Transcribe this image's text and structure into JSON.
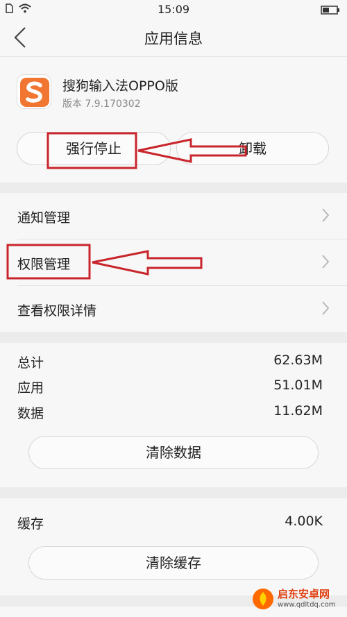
{
  "status_bar": {
    "time": "15:09",
    "icons": [
      "sim-card-icon",
      "wifi-icon",
      "battery-icon"
    ]
  },
  "header": {
    "title": "应用信息",
    "back_icon": "chevron-left-icon"
  },
  "app": {
    "name": "搜狗输入法OPPO版",
    "version": "版本 7.9.170302",
    "icon": "sogou-logo",
    "brand_color": "#f07632"
  },
  "actions": {
    "force_stop": "强行停止",
    "uninstall": "卸载"
  },
  "menu": [
    {
      "label": "通知管理",
      "icon": "chevron-right-icon"
    },
    {
      "label": "权限管理",
      "icon": "chevron-right-icon"
    },
    {
      "label": "查看权限详情",
      "icon": "chevron-right-icon"
    }
  ],
  "storage": {
    "rows": [
      {
        "label": "总计",
        "value": "62.63M"
      },
      {
        "label": "应用",
        "value": "51.01M"
      },
      {
        "label": "数据",
        "value": "11.62M"
      }
    ],
    "clear_data": "清除数据"
  },
  "cache": {
    "label": "缓存",
    "value": "4.00K",
    "clear_cache": "清除缓存"
  },
  "annotation_color": "#c9252c",
  "watermark": {
    "text": "启东安卓网",
    "url": "www.qdltdq.com"
  }
}
